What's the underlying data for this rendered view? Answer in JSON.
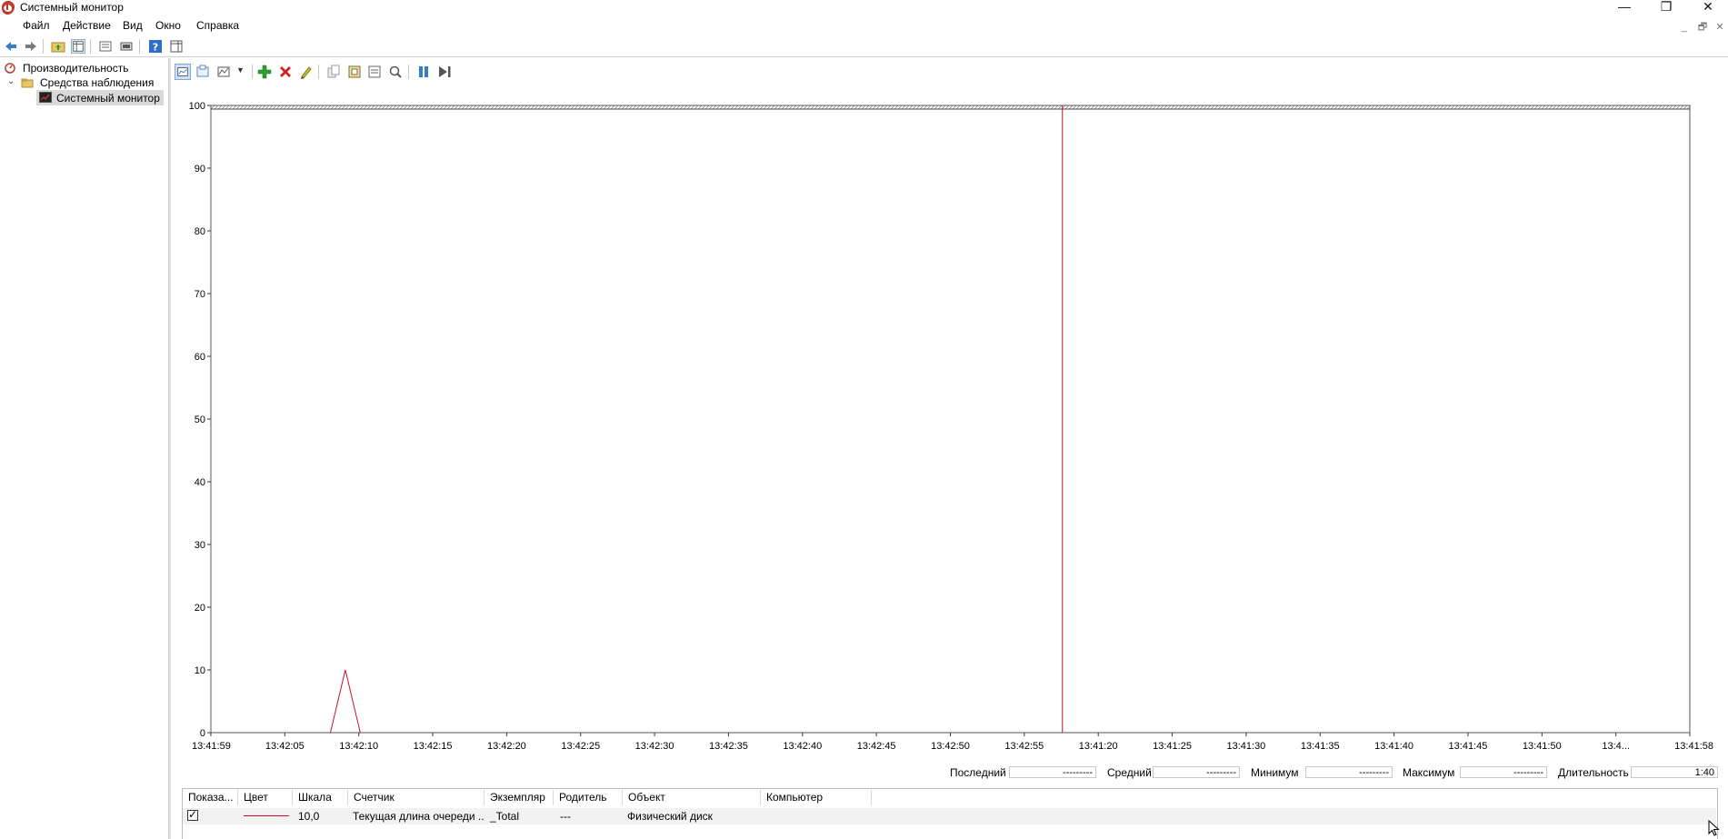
{
  "window": {
    "title": "Системный монитор",
    "controls": {
      "minimize": "—",
      "restore": "❐",
      "close": "✕"
    },
    "mdi_controls": {
      "minimize": "_",
      "restore": "🗗",
      "close": "✕"
    }
  },
  "menu": [
    "Файл",
    "Действие",
    "Вид",
    "Окно",
    "Справка"
  ],
  "tree": {
    "root": "Производительность",
    "group": "Средства наблюдения",
    "selected": "Системный монитор"
  },
  "colors": {
    "series": "#c8102e",
    "accent_blue": "#2f7fc9",
    "add_green": "#2e9e2e",
    "delete_red": "#d32020"
  },
  "chart_data": {
    "type": "line",
    "ylim": [
      0,
      100
    ],
    "yticks": [
      0,
      10,
      20,
      30,
      40,
      50,
      60,
      70,
      80,
      90,
      100
    ],
    "xtick_labels": [
      "13:41:59",
      "13:42:05",
      "13:42:10",
      "13:42:15",
      "13:42:20",
      "13:42:25",
      "13:42:30",
      "13:42:35",
      "13:42:40",
      "13:42:45",
      "13:42:50",
      "13:42:55",
      "13:41:20",
      "13:41:25",
      "13:41:30",
      "13:41:35",
      "13:41:40",
      "13:41:45",
      "13:41:50",
      "13:4...",
      "13:41:58"
    ],
    "series": [
      {
        "values": [
          0,
          0,
          0,
          0,
          0,
          0,
          0,
          0,
          0,
          10,
          0,
          0,
          0,
          0,
          0,
          0,
          0,
          0,
          0,
          0,
          0,
          0,
          0,
          0,
          0,
          0,
          0,
          0,
          0,
          0,
          0,
          0,
          0,
          0,
          0,
          0,
          0,
          0,
          0,
          0,
          0,
          0,
          0,
          0,
          0,
          0,
          0,
          0,
          0,
          0,
          0,
          0,
          0,
          0,
          0,
          0,
          0,
          0,
          0,
          0,
          0,
          0,
          0,
          0,
          0,
          0,
          0,
          0,
          0,
          0,
          0,
          0,
          0,
          0,
          0,
          0,
          0,
          0,
          0,
          0,
          0,
          0,
          0,
          0,
          0,
          0,
          0,
          0,
          0,
          0,
          0,
          0,
          0,
          0,
          0,
          0,
          0,
          0,
          0,
          0
        ],
        "visible_until_index": 9
      }
    ],
    "cursor_index": 57,
    "grid": false
  },
  "stats": {
    "last_label": "Последний",
    "last_value": "---------",
    "avg_label": "Средний",
    "avg_value": "---------",
    "min_label": "Минимум",
    "min_value": "---------",
    "max_label": "Максимум",
    "max_value": "---------",
    "duration_label": "Длительность",
    "duration_value": "1:40"
  },
  "legend": {
    "headers": [
      "Показа...",
      "Цвет",
      "Шкала",
      "Счетчик",
      "Экземпляр",
      "Родитель",
      "Объект",
      "Компьютер"
    ],
    "rows": [
      {
        "show": true,
        "scale": "10,0",
        "counter": "Текущая длина очереди ...",
        "instance": "_Total",
        "parent": "---",
        "object": "Физический диск",
        "computer": ""
      }
    ]
  }
}
